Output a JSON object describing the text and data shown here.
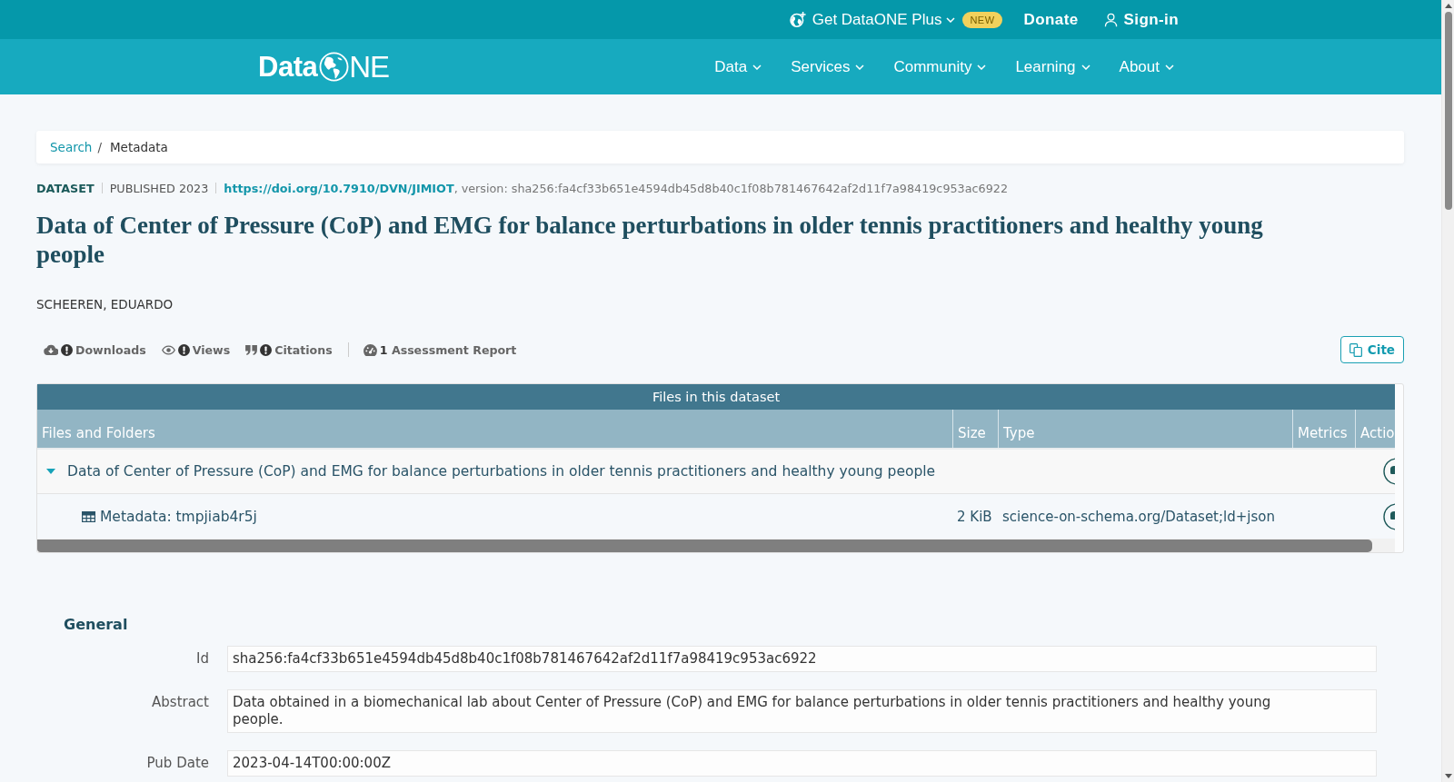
{
  "top_bar": [
    {
      "kind": "dropdown",
      "label": "Get DataONE Plus",
      "badge": "NEW"
    },
    {
      "kind": "link",
      "label": "Donate"
    },
    {
      "kind": "account",
      "label": "Sign-in"
    }
  ],
  "nav": {
    "logo": {
      "lead": "Data",
      "tail": "NE"
    },
    "items": [
      "Data",
      "Services",
      "Community",
      "Learning",
      "About"
    ]
  },
  "breadcrumb": {
    "separator": "/",
    "items": [
      {
        "kind": "link",
        "label": "Search"
      },
      {
        "kind": "current",
        "label": "Metadata"
      }
    ]
  },
  "dataset": {
    "type": "DATASET",
    "published": "PUBLISHED 2023",
    "doi": "https://doi.org/10.7910/DVN/JIMIOT",
    "version": ", version: sha256:fa4cf33b651e4594db45d8b40c1f08b781467642af2d11f7a98419c953ac6922",
    "title": "Data of Center of Pressure (CoP) and EMG for balance perturbations in older tennis practitioners and healthy young people",
    "author": "SCHEEREN, EDUARDO"
  },
  "metrics": [
    {
      "label": "Downloads"
    },
    {
      "label": "Views"
    },
    {
      "label": "Citations"
    }
  ],
  "assessment": {
    "label": "**1** Assessment Report"
  },
  "cite_button": {
    "label": "Cite"
  },
  "table": {
    "caption": "Files in this dataset",
    "columns": [
      "Files and Folders",
      "Size",
      "Type",
      "Metrics",
      "Actio"
    ],
    "rows": [
      {
        "kind": "folder",
        "name": "Data of Center of Pressure (CoP) and EMG for balance perturbations in older tennis practitioners and healthy young people",
        "expanded": true,
        "children": [
          {
            "kind": "file",
            "name": "Metadata: tmpjiab4r5j",
            "size": "2 KiB",
            "type": "science-on-schema.org/Dataset;ld+json"
          }
        ]
      }
    ]
  },
  "general": {
    "heading": "General",
    "fields": [
      {
        "label": "Id",
        "value": "sha256:fa4cf33b651e4594db45d8b40c1f08b781467642af2d11f7a98419c953ac6922"
      },
      {
        "label": "Abstract",
        "value": "Data obtained in a biomechanical lab about Center of Pressure (CoP) and EMG for balance perturbations in older tennis practitioners and healthy young people."
      },
      {
        "label": "Pub Date",
        "value": "2023-04-14T00:00:00Z"
      }
    ]
  }
}
